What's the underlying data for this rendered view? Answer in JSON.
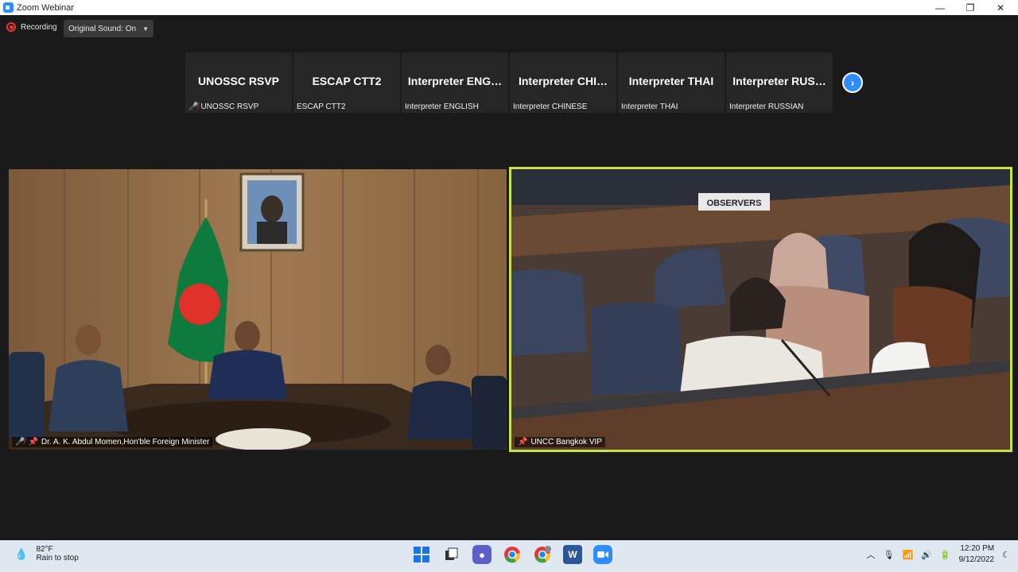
{
  "window": {
    "title": "Zoom Webinar",
    "minimize": "—",
    "maximize": "❐",
    "close": "✕"
  },
  "recording": {
    "label": "Recording",
    "sound_label": "Original Sound: On"
  },
  "participants": [
    {
      "name": "UNOSSC RSVP",
      "label": "UNOSSC RSVP",
      "muted": true
    },
    {
      "name": "ESCAP CTT2",
      "label": "ESCAP CTT2",
      "muted": false
    },
    {
      "name": "Interpreter  ENG…",
      "label": "Interpreter ENGLISH",
      "muted": false
    },
    {
      "name": "Interpreter  CHI…",
      "label": "Interpreter CHINESE",
      "muted": false
    },
    {
      "name": "Interpreter THAI",
      "label": "Interpreter THAI",
      "muted": false
    },
    {
      "name": "Interpreter  RUS…",
      "label": "Interpreter RUSSIAN",
      "muted": false
    }
  ],
  "videos": {
    "left_caption": "Dr. A. K. Abdul Momen,Hon'ble Foreign Minister",
    "right_caption": "UNCC Bangkok VIP",
    "observers_sign": "OBSERVERS"
  },
  "taskbar": {
    "temperature": "82°F",
    "weather": "Rain to stop",
    "time": "12:20 PM",
    "date": "9/12/2022"
  }
}
